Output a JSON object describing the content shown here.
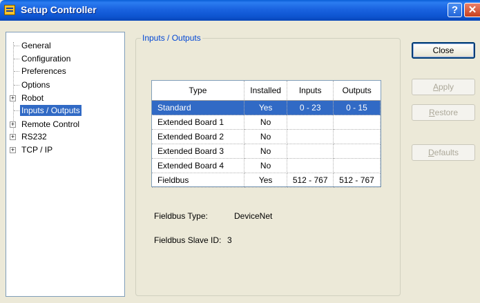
{
  "window": {
    "title": "Setup Controller",
    "help_glyph": "?",
    "close_glyph": "✕"
  },
  "tree": {
    "items": [
      {
        "label": "General"
      },
      {
        "label": "Configuration"
      },
      {
        "label": "Preferences"
      },
      {
        "label": "Options"
      },
      {
        "label": "Robot",
        "expander": "+"
      },
      {
        "label": "Inputs / Outputs",
        "selected": true
      },
      {
        "label": "Remote Control",
        "expander": "+"
      },
      {
        "label": "RS232",
        "expander": "+"
      },
      {
        "label": "TCP / IP",
        "expander": "+"
      }
    ]
  },
  "panel": {
    "group_title": "Inputs / Outputs",
    "table": {
      "headers": [
        "Type",
        "Installed",
        "Inputs",
        "Outputs"
      ],
      "rows": [
        [
          "Standard",
          "Yes",
          "0 - 23",
          "0 - 15"
        ],
        [
          "Extended Board 1",
          "No",
          "",
          ""
        ],
        [
          "Extended Board 2",
          "No",
          "",
          ""
        ],
        [
          "Extended Board 3",
          "No",
          "",
          ""
        ],
        [
          "Extended Board 4",
          "No",
          "",
          ""
        ],
        [
          "Fieldbus",
          "Yes",
          "512 - 767",
          "512 - 767"
        ]
      ]
    },
    "fieldbus_type_label": "Fieldbus Type:",
    "fieldbus_type_value": "DeviceNet",
    "fieldbus_slave_label": "Fieldbus Slave ID:",
    "fieldbus_slave_value": "3"
  },
  "buttons": {
    "close": "Close",
    "apply_first": "A",
    "apply_rest": "pply",
    "restore_first": "R",
    "restore_rest": "estore",
    "defaults_first": "D",
    "defaults_rest": "efaults"
  },
  "colors": {
    "selection": "#316ac5",
    "titlebar": "#0a5fd6",
    "group_title": "#0046d5"
  }
}
